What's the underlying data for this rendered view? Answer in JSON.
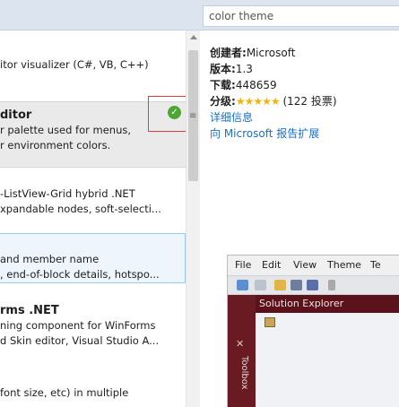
{
  "search": {
    "value": "color theme"
  },
  "list": {
    "item1": {
      "desc1": "itor visualizer (C#, VB, C++)"
    },
    "item2": {
      "title": "ditor",
      "desc1": "r palette used for menus,",
      "desc2": "r environment colors."
    },
    "item3": {
      "desc1": "-ListView-Grid hybrid .NET",
      "desc2": "xpandable nodes, soft-selecti..."
    },
    "item4": {
      "desc1": " and member name",
      "desc2": ", end-of-block details, hotspo..."
    },
    "item5": {
      "title": "rms .NET",
      "desc1": "ning component for WinForms",
      "desc2": "d Skin editor, Visual Studio A..."
    },
    "item6": {
      "desc1": " font size, etc) in multiple"
    }
  },
  "details": {
    "creator_label": "创建者:",
    "creator_value": "Microsoft",
    "version_label": "版本:",
    "version_value": "1.3",
    "downloads_label": "下载:",
    "downloads_value": "448659",
    "rating_label": "分级:",
    "rating_stars": "★★★★★",
    "rating_votes": "(122 投票)",
    "more_info_link": "详细信息",
    "report_link": "向 Microsoft 报告扩展"
  },
  "preview": {
    "menus": [
      "File",
      "Edit",
      "View",
      "Theme",
      "Te"
    ],
    "toolbox_label": "Toolbox",
    "panel_title": "Solution Explorer"
  },
  "colors": {
    "accent_link": "#1a6fc4",
    "installed_check": "#4da534",
    "highlight_box": "#e43b3b",
    "theme_dark": "#6a1a22"
  }
}
